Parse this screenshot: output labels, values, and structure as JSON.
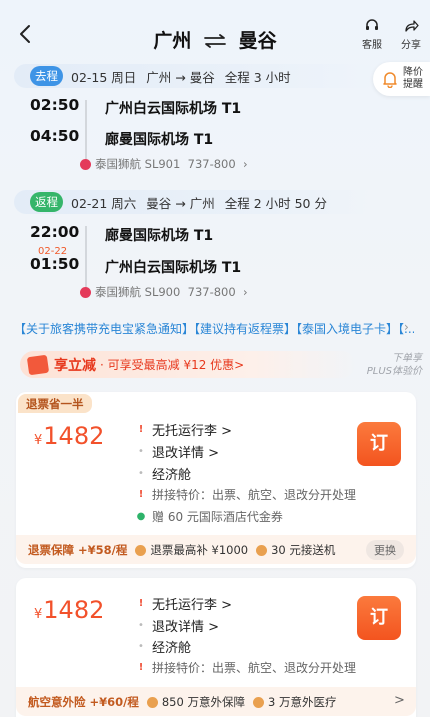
{
  "header": {
    "origin": "广州",
    "destination": "曼谷",
    "service_label": "客服",
    "share_label": "分享"
  },
  "price_alert": {
    "line1": "降价",
    "line2": "提醒"
  },
  "outbound": {
    "tag": "去程",
    "date": "02-15 周日",
    "route": "广州 → 曼谷",
    "duration": "全程 3 小时",
    "dep_time": "02:50",
    "dep_airport": "广州白云国际机场 T1",
    "arr_time": "04:50",
    "arr_airport": "廊曼国际机场 T1",
    "airline": "泰国狮航 SL901",
    "aircraft": "737-800"
  },
  "inbound": {
    "tag": "返程",
    "date": "02-21 周六",
    "route": "曼谷 → 广州",
    "duration": "全程 2 小时 50 分",
    "dep_time": "22:00",
    "dep_airport": "廊曼国际机场 T1",
    "arr_date_note": "02-22",
    "arr_time": "01:50",
    "arr_airport": "广州白云国际机场 T1",
    "airline": "泰国狮航 SL900",
    "aircraft": "737-800"
  },
  "notice": "【关于旅客携带充电宝紧急通知】【建议持有返程票】【泰国入境电子卡】【...",
  "promo": {
    "title": "享立减",
    "subtitle": "· 可享受最高减 ¥12 优惠>"
  },
  "plus": {
    "line1": "下单享",
    "line2": "PLUS体验价"
  },
  "tickets": [
    {
      "badge": "退票省一半",
      "currency": "¥",
      "price": "1482",
      "features": [
        "无托运行李 >",
        "退改详情 >",
        "经济舱",
        "拼接特价：出票、航空、退改分开处理",
        "赠 60 元国际酒店代金券"
      ],
      "book_label": "订",
      "footer": {
        "lead": "退票保障 +¥58/程",
        "items": [
          "退票最高补 ¥1000",
          "30 元接送机"
        ],
        "action": "更换"
      }
    },
    {
      "currency": "¥",
      "price": "1482",
      "features": [
        "无托运行李 >",
        "退改详情 >",
        "经济舱",
        "拼接特价：出票、航空、退改分开处理"
      ],
      "book_label": "订",
      "footer": {
        "lead": "航空意外险 +¥60/程",
        "items": [
          "850 万意外保障",
          "3 万意外医疗"
        ],
        "action": ">"
      }
    }
  ],
  "colors": {
    "accent": "#f2512b",
    "outbound_tag": "#3e94e6",
    "return_tag": "#35b56a",
    "link": "#2a86d6"
  }
}
